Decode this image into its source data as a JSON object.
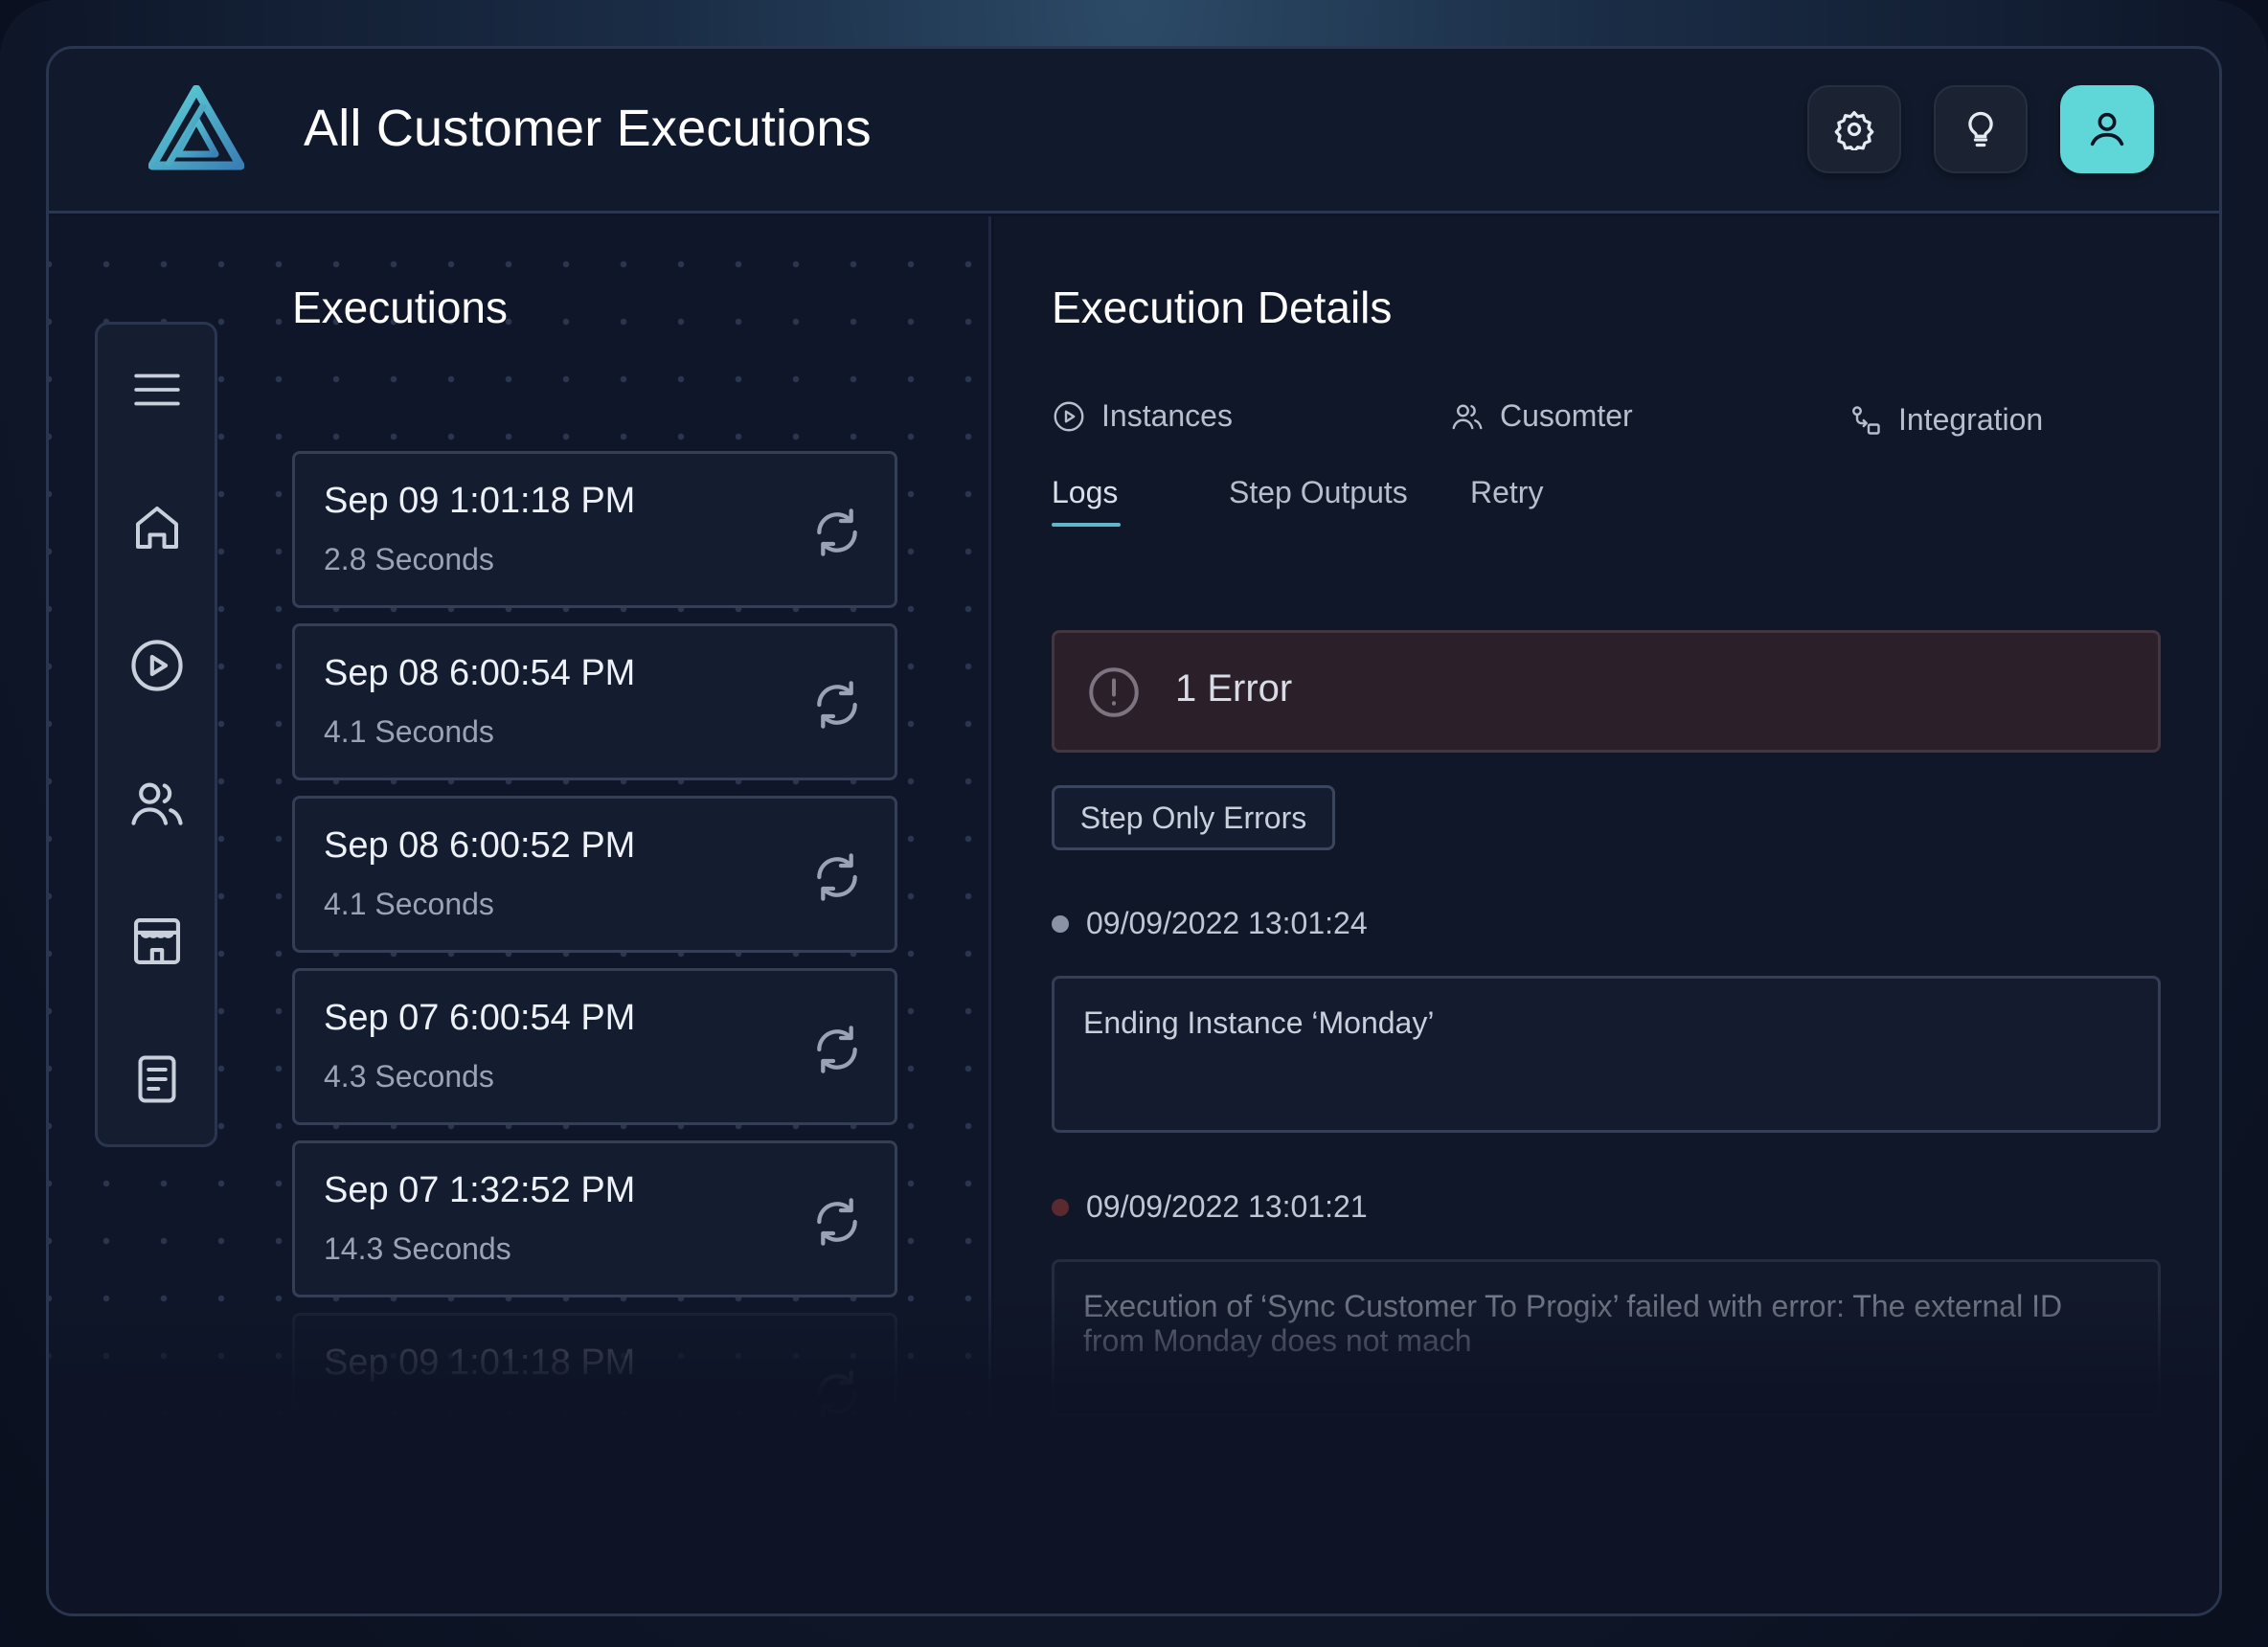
{
  "header": {
    "title": "All Customer Executions",
    "buttons": [
      "settings-icon",
      "lightbulb-icon",
      "user-icon"
    ],
    "active_button_color": "#5fd6d8"
  },
  "sidebar": {
    "icons": [
      "menu-icon",
      "home-icon",
      "play-icon",
      "users-icon",
      "store-icon",
      "document-icon"
    ]
  },
  "executions": {
    "title": "Executions",
    "items": [
      {
        "time": "Sep 09 1:01:18 PM",
        "duration": "2.8 Seconds"
      },
      {
        "time": "Sep 08 6:00:54 PM",
        "duration": "4.1 Seconds"
      },
      {
        "time": "Sep 08 6:00:52 PM",
        "duration": "4.1 Seconds"
      },
      {
        "time": "Sep 07 6:00:54 PM",
        "duration": "4.3 Seconds"
      },
      {
        "time": "Sep 07 1:32:52 PM",
        "duration": "14.3 Seconds"
      },
      {
        "time": "Sep 09 1:01:18 PM",
        "duration": ""
      }
    ]
  },
  "details": {
    "title": "Execution Details",
    "info": {
      "instances": "Instances",
      "customer": "Cusomter",
      "integration": "Integration"
    },
    "tabs": [
      "Logs",
      "Step Outputs",
      "Retry"
    ],
    "active_tab": "Logs",
    "error_banner": "1 Error",
    "error_color": "#2b1f2a",
    "filter_button": "Step Only Errors",
    "logs": [
      {
        "timestamp": "09/09/2022  13:01:24",
        "message": "Ending Instance ‘Monday’",
        "dot_color": "#8a93a5"
      },
      {
        "timestamp": "09/09/2022  13:01:21",
        "message": "Execution of ‘Sync Customer To Progix’ failed with error: The external ID from Monday does not mach",
        "dot_color": "#5a2a30"
      }
    ]
  }
}
